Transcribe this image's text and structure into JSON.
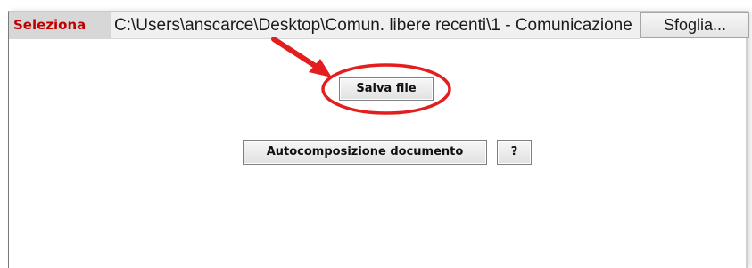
{
  "file_selector": {
    "label": "Seleziona",
    "path_value": "C:\\Users\\anscarce\\Desktop\\Comun. libere recenti\\1 - Comunicazione",
    "browse_label": "Sfoglia..."
  },
  "actions": {
    "save_label": "Salva file",
    "autocompose_label": "Autocomposizione documento",
    "help_label": "?"
  },
  "colors": {
    "label_text": "#c00000",
    "annotation": "#e41e1e"
  }
}
